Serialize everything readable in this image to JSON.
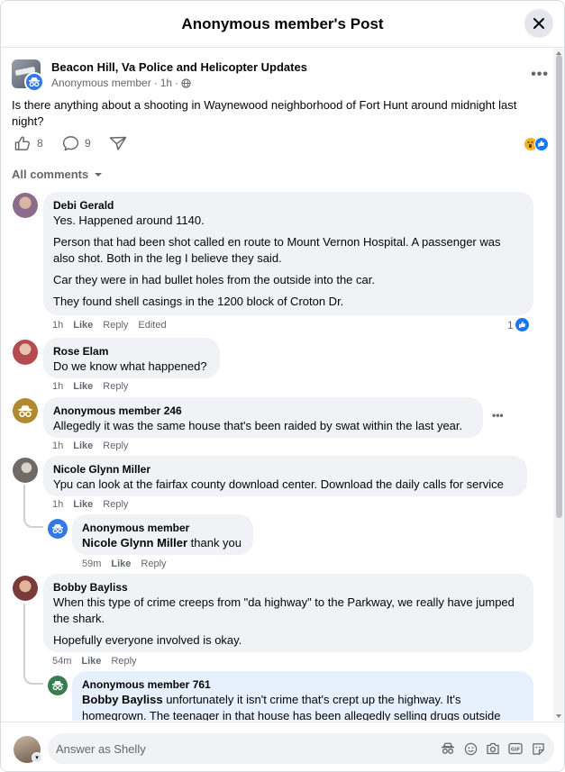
{
  "dialog": {
    "title": "Anonymous member's Post",
    "close_icon": "close-icon"
  },
  "post": {
    "group_name": "Beacon Hill, Va Police and Helicopter Updates",
    "author": "Anonymous member",
    "time": "1h",
    "privacy_icon": "globe-icon",
    "text": "Is there anything about a shooting in Waynewood neighborhood of Fort Hunt around midnight last night?",
    "likes": "8",
    "comments": "9",
    "reactions": [
      "wow",
      "like"
    ]
  },
  "comments_filter": "All comments",
  "comments": [
    {
      "name": "Debi Gerald",
      "paragraphs": [
        "Yes. Happened around 1140.",
        "Person that had been shot called en route to Mount Vernon Hospital. A passenger was also shot. Both in the leg I believe they said.",
        "Car they were in had bullet holes from the outside into the car.",
        "They found shell casings in the 1200 block of Croton Dr."
      ],
      "time": "1h",
      "like": "Like",
      "reply": "Reply",
      "edited": "Edited",
      "reaction_count": "1"
    },
    {
      "name": "Rose Elam",
      "text": "Do we know what happened?",
      "time": "1h",
      "like": "Like",
      "reply": "Reply"
    },
    {
      "name": "Anonymous member 246",
      "text": "Allegedly it was the same house that's been raided by swat within the last year.",
      "time": "1h",
      "like": "Like",
      "reply": "Reply"
    },
    {
      "name": "Nicole Glynn Miller",
      "text": "Ypu can look at the fairfax county download center. Download the daily calls for service",
      "time": "1h",
      "like": "Like",
      "reply": "Reply"
    },
    {
      "name": "Anonymous member",
      "mention": "Nicole Glynn Miller",
      "text": " thank you",
      "time": "59m",
      "like": "Like",
      "reply": "Reply"
    },
    {
      "name": "Bobby Bayliss",
      "paragraphs": [
        "When this type of crime creeps from \"da highway\" to the Parkway, we really have jumped the shark.",
        "Hopefully everyone involved is okay."
      ],
      "time": "54m",
      "like": "Like",
      "reply": "Reply"
    },
    {
      "name": "Anonymous member 761",
      "mention": "Bobby Bayliss",
      "text": " unfortunately it isn't crime that's crept up the highway. It's homegrown. The teenager in that house has been allegedly selling drugs outside"
    }
  ],
  "composer": {
    "placeholder": "Answer as Shelly"
  },
  "colors": {
    "brand_blue": "#1877f2",
    "anon_blue": "#3578e5",
    "anon_gold": "#b08a2e",
    "anon_green": "#3b7d53",
    "bubble_grey": "#f0f2f5",
    "secondary_text": "#65676b"
  }
}
